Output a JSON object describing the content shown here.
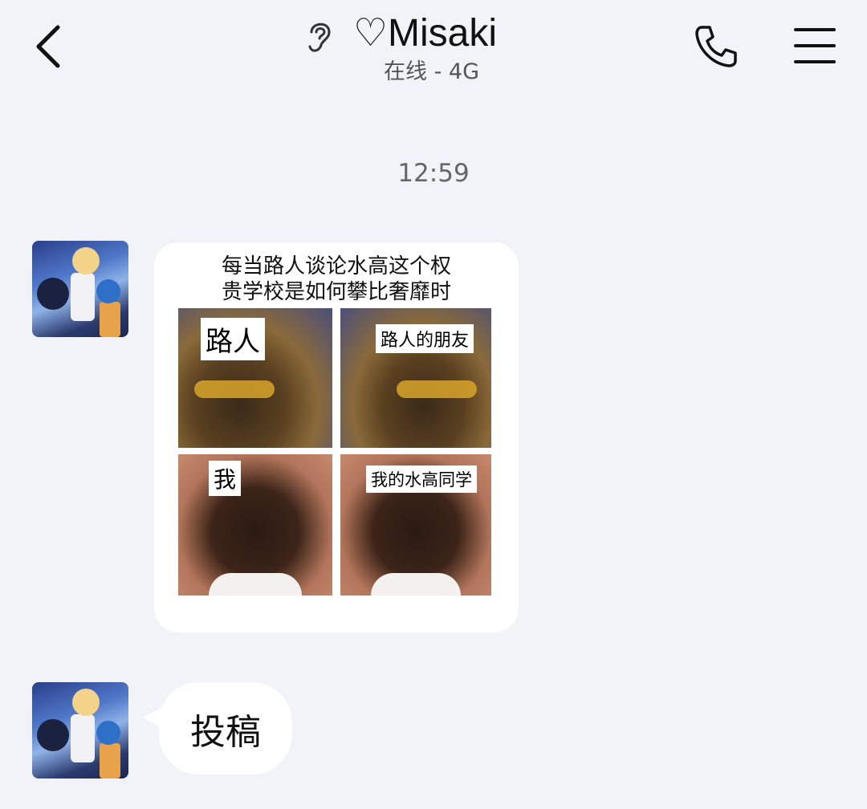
{
  "header": {
    "title": "♡Misaki",
    "status": "在线 - 4G"
  },
  "chat": {
    "timestamp": "12:59",
    "messages": [
      {
        "type": "image",
        "meme": {
          "caption_line1": "每当路人谈论水高这个权",
          "caption_line2": "贵学校是如何攀比奢靡时",
          "labels": [
            "路人",
            "路人的朋友",
            "我",
            "我的水高同学"
          ]
        }
      },
      {
        "type": "text",
        "text": "投稿"
      }
    ]
  },
  "colors": {
    "background": "#f2f3f8",
    "bubble": "#ffffff"
  }
}
